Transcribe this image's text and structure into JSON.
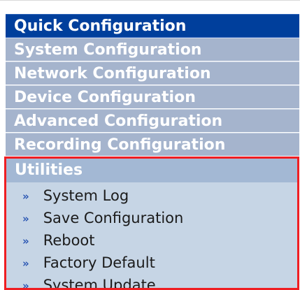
{
  "menu": {
    "sections": [
      {
        "label": "Quick Configuration",
        "active": true
      },
      {
        "label": "System Configuration",
        "active": false
      },
      {
        "label": "Network Configuration",
        "active": false
      },
      {
        "label": "Device Configuration",
        "active": false
      },
      {
        "label": "Advanced Configuration",
        "active": false
      },
      {
        "label": "Recording Configuration",
        "active": false
      }
    ],
    "utilities": {
      "label": "Utilities",
      "items": [
        {
          "label": "System Log",
          "icon": "double-chevron-right-icon"
        },
        {
          "label": "Save Configuration",
          "icon": "double-chevron-right-icon"
        },
        {
          "label": "Reboot",
          "icon": "double-chevron-right-icon"
        },
        {
          "label": "Factory Default",
          "icon": "double-chevron-right-icon"
        },
        {
          "label": "System Update",
          "icon": "double-chevron-right-icon"
        }
      ]
    }
  },
  "colors": {
    "active_section": "#003f9c",
    "inactive_section": "#a5b4cd",
    "utilities_highlight": "#ef1e22",
    "submenu_background": "#c6d5e5",
    "bullet": "#2a56b3"
  }
}
